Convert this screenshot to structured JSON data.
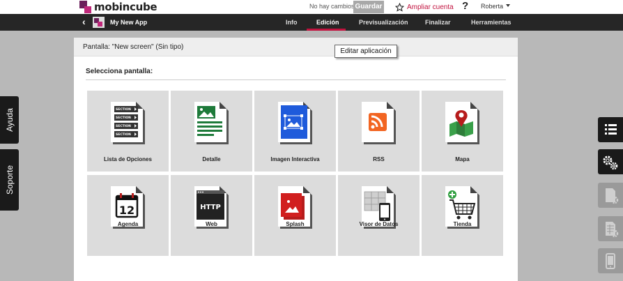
{
  "topbar": {
    "logo_text": "mobincube",
    "status": "No hay cambios",
    "save_label": "Guardar",
    "upgrade_label": "Ampliar cuenta",
    "help_label": "?",
    "user_name": "Roberta"
  },
  "nav": {
    "app_name": "My New App",
    "tabs": [
      "Info",
      "Edición",
      "Previsualización",
      "Finalizar",
      "Herramientas"
    ],
    "active_tab": "Edición"
  },
  "side_left": {
    "help": "Ayuda",
    "support": "Soporte"
  },
  "panel": {
    "title": "Pantalla: \"New screen\" (Sin tipo)",
    "section_title": "Selecciona pantalla:"
  },
  "tooltip": "Editar aplicación",
  "screens": [
    {
      "label": "Lista de Opciones",
      "icon": "list-options-icon"
    },
    {
      "label": "Detalle",
      "icon": "detail-icon"
    },
    {
      "label": "Imagen Interactiva",
      "icon": "interactive-image-icon"
    },
    {
      "label": "RSS",
      "icon": "rss-icon"
    },
    {
      "label": "Mapa",
      "icon": "map-icon"
    },
    {
      "label": "Agenda",
      "icon": "calendar-icon"
    },
    {
      "label": "Web",
      "icon": "web-icon"
    },
    {
      "label": "Splash",
      "icon": "splash-icon"
    },
    {
      "label": "Visor de Datos",
      "icon": "data-viewer-icon"
    },
    {
      "label": "Tienda",
      "icon": "shop-icon"
    }
  ],
  "list_section_labels": [
    "SECTION",
    "SECTION",
    "SECTION",
    "SECTION"
  ],
  "calendar_day": "12",
  "web_text": "HTTP",
  "colors": {
    "accent": "#c1123e",
    "navbar": "#262626",
    "brand_dark": "#6b1f5a",
    "brand_pink": "#c0287a"
  }
}
